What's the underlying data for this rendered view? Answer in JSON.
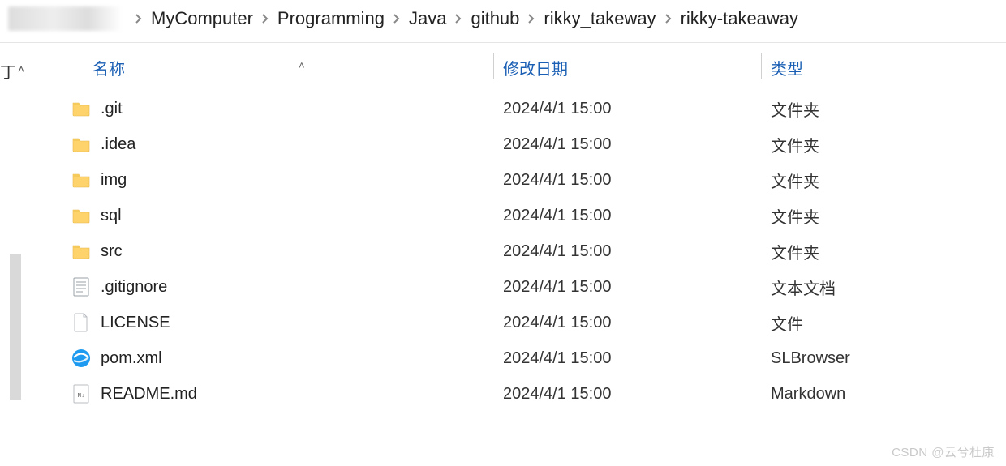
{
  "breadcrumb": {
    "items": [
      "MyComputer",
      "Programming",
      "Java",
      "github",
      "rikky_takeway",
      "rikky-takeaway"
    ]
  },
  "leftGutter": {
    "label": "丁"
  },
  "headers": {
    "name": "名称",
    "date": "修改日期",
    "type": "类型"
  },
  "files": [
    {
      "name": ".git",
      "date": "2024/4/1 15:00",
      "type": "文件夹",
      "icon": "folder"
    },
    {
      "name": ".idea",
      "date": "2024/4/1 15:00",
      "type": "文件夹",
      "icon": "folder"
    },
    {
      "name": "img",
      "date": "2024/4/1 15:00",
      "type": "文件夹",
      "icon": "folder"
    },
    {
      "name": "sql",
      "date": "2024/4/1 15:00",
      "type": "文件夹",
      "icon": "folder"
    },
    {
      "name": "src",
      "date": "2024/4/1 15:00",
      "type": "文件夹",
      "icon": "folder"
    },
    {
      "name": ".gitignore",
      "date": "2024/4/1 15:00",
      "type": "文本文档",
      "icon": "text"
    },
    {
      "name": "LICENSE",
      "date": "2024/4/1 15:00",
      "type": "文件",
      "icon": "file"
    },
    {
      "name": "pom.xml",
      "date": "2024/4/1 15:00",
      "type": "SLBrowser",
      "icon": "browser"
    },
    {
      "name": "README.md",
      "date": "2024/4/1 15:00",
      "type": "Markdown",
      "icon": "md"
    }
  ],
  "watermark": "CSDN @云兮杜康"
}
